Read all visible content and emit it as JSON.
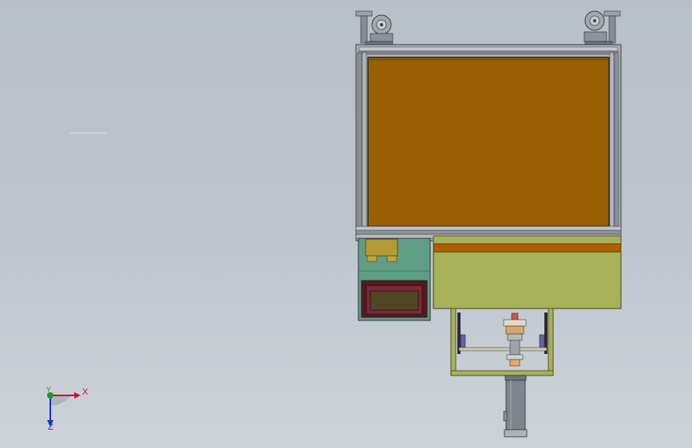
{
  "triad": {
    "x_label": "X",
    "y_label": "Y",
    "z_label": "Z",
    "x_color": "#c8102e",
    "y_color": "#1a9a2a",
    "z_color": "#1b2fc2"
  },
  "colors": {
    "background_top": "#b8bfc7",
    "frame": "#6e747c",
    "panel_orange": "#9a5f00",
    "base_green": "#a7b257",
    "control_box": "#5f9e86",
    "display_frame": "#5a1822",
    "cylinder": "#7f858c"
  },
  "icons": {
    "caster_wheel": "caster-wheel-icon",
    "axis_triad": "axis-triad-icon"
  }
}
